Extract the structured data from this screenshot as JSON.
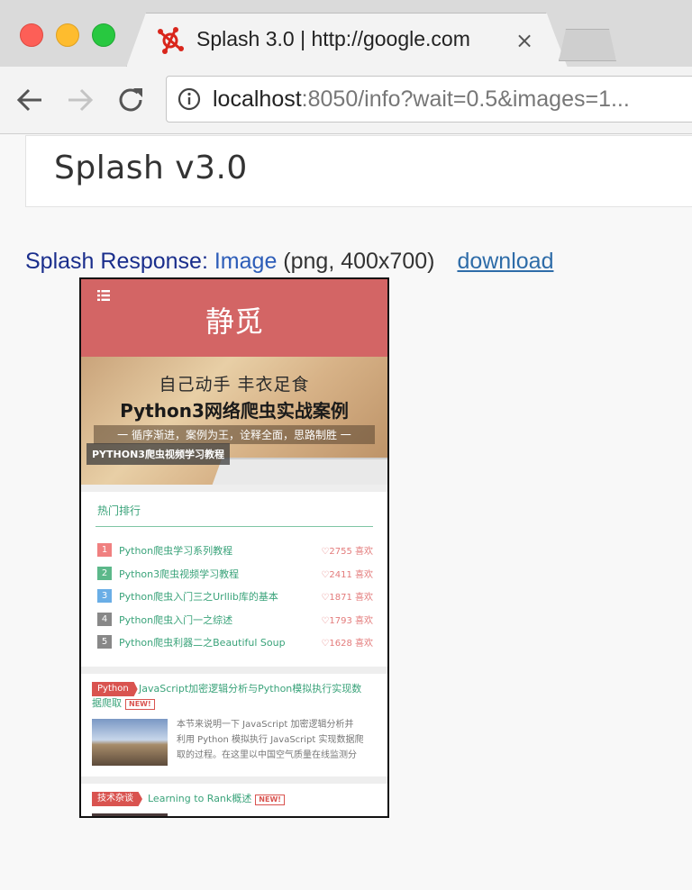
{
  "browser": {
    "tab_title": "Splash 3.0 | http://google.com",
    "tab_close": "×",
    "url_host": "localhost",
    "url_rest": ":8050/info?wait=0.5&images=1..."
  },
  "page": {
    "title": "Splash v3.0",
    "response_label": "Splash Response:",
    "response_type": "Image",
    "response_format": "(png, 400x700)",
    "download_label": "download"
  },
  "screenshot": {
    "site_name": "静觅",
    "banner": {
      "line1": "自己动手  丰衣足食",
      "line2": "Python3网络爬虫实战案例",
      "line3": "一 循序渐进，案例为王，诠释全面，思路制胜 一",
      "tag": "PYTHON3爬虫视频学习教程"
    },
    "hot": {
      "title": "热门排行",
      "items": [
        {
          "rank": "1",
          "title": "Python爬虫学习系列教程",
          "likes": "♡2755 喜欢",
          "color": "#f08080"
        },
        {
          "rank": "2",
          "title": "Python3爬虫视频学习教程",
          "likes": "♡2411 喜欢",
          "color": "#5cb88a"
        },
        {
          "rank": "3",
          "title": "Python爬虫入门三之Urllib库的基本",
          "likes": "♡1871 喜欢",
          "color": "#6aaee6"
        },
        {
          "rank": "4",
          "title": "Python爬虫入门一之综述",
          "likes": "♡1793 喜欢",
          "color": "#888888"
        },
        {
          "rank": "5",
          "title": "Python爬虫利器二之Beautiful Soup",
          "likes": "♡1628 喜欢",
          "color": "#888888"
        }
      ]
    },
    "posts": [
      {
        "tag": "Python",
        "title_line1": "JavaScript加密逻辑分析与Python模拟执行实现数",
        "title_line2": "据爬取",
        "new_label": "NEW!",
        "summary_line1": "本节来说明一下 JavaScript 加密逻辑分析并",
        "summary_line2": "利用 Python 模拟执行 JavaScript 实现数据爬",
        "summary_line3": "取的过程。在这里以中国空气质量在线监测分"
      },
      {
        "tag": "技术杂谈",
        "title_line1": "Learning to Rank概述",
        "new_label": "NEW!"
      }
    ]
  }
}
